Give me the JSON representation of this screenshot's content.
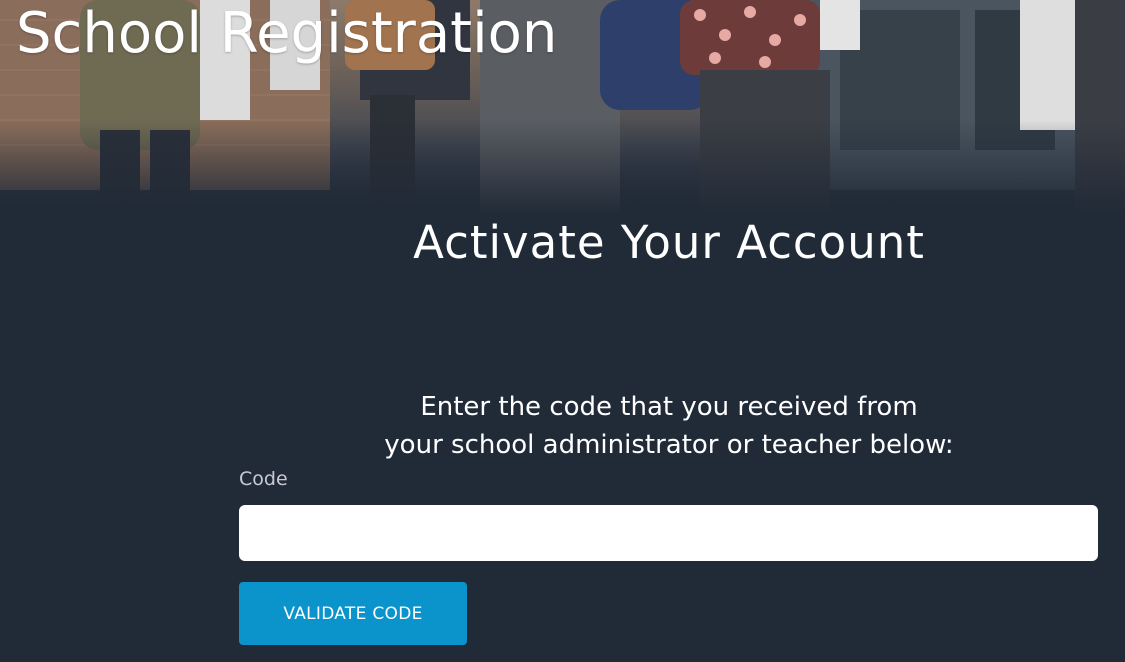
{
  "header": {
    "site_title": "School Registration"
  },
  "main": {
    "heading": "Activate Your Account",
    "instructions_line1": "Enter the code that you received from",
    "instructions_line2": "your school administrator or teacher below:",
    "code_label": "Code",
    "code_value": "",
    "validate_button_label": "VALIDATE CODE"
  },
  "colors": {
    "background": "#212a37",
    "button": "#0b93cc",
    "input_background": "#ffffff",
    "label": "#c6cbd2"
  }
}
